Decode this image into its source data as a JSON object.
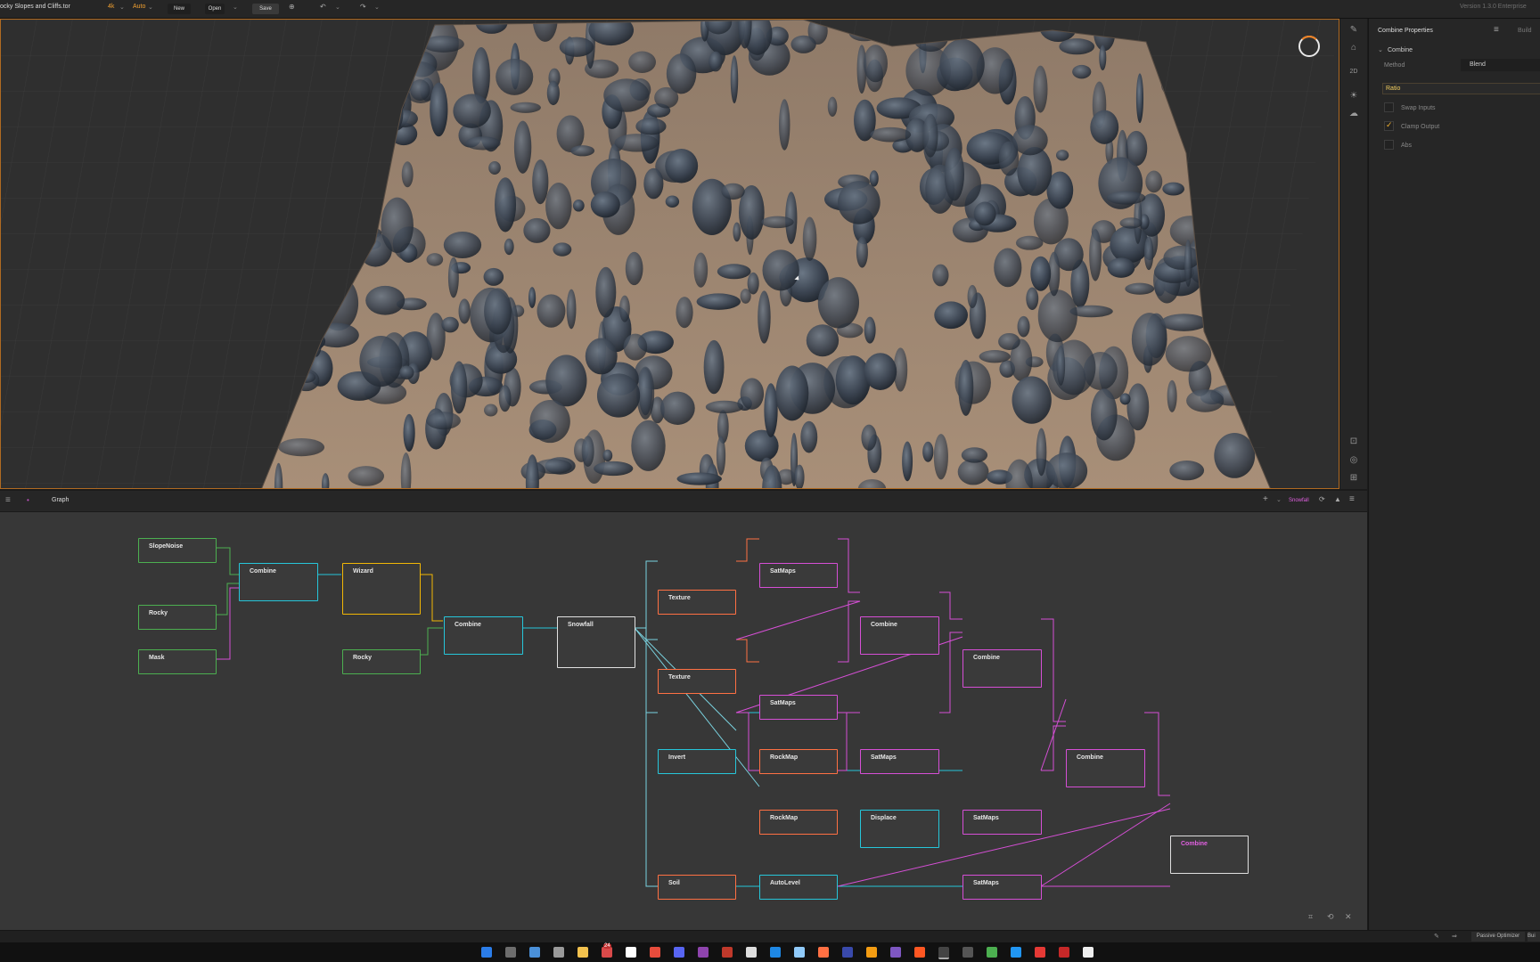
{
  "titlebar": {
    "file_name": "ocky Slopes and Cliffs.tor",
    "resolution": "4k",
    "mode": "Auto",
    "new_label": "New",
    "open_label": "Open",
    "save_label": "Save",
    "version": "Version 1.3.0 Enterprise"
  },
  "viewport": {
    "accent_color": "#b06a22"
  },
  "viewport_tools": {
    "zoom_2d_label": "2D"
  },
  "properties": {
    "panel_title": "Combine Properties",
    "build_label": "Build",
    "section_title": "Combine",
    "method_label": "Method",
    "method_value": "Blend",
    "ratio_label": "Ratio",
    "options": [
      {
        "label": "Swap Inputs",
        "checked": false
      },
      {
        "label": "Clamp Output",
        "checked": true
      },
      {
        "label": "Abs",
        "checked": false
      }
    ]
  },
  "graph": {
    "tab_label": "Graph",
    "active_build": "Snowfall",
    "nodes": [
      {
        "label": "SlopeNoise",
        "color": "green"
      },
      {
        "label": "Rocky",
        "color": "green"
      },
      {
        "label": "Mask",
        "color": "green"
      },
      {
        "label": "Combine",
        "color": "cyan"
      },
      {
        "label": "Wizard",
        "color": "yellow"
      },
      {
        "label": "Rocky",
        "color": "green"
      },
      {
        "label": "Combine",
        "color": "cyan"
      },
      {
        "label": "Snowfall",
        "color": "white"
      },
      {
        "label": "Texture",
        "color": "orange"
      },
      {
        "label": "Texture",
        "color": "orange"
      },
      {
        "label": "Invert",
        "color": "cyan"
      },
      {
        "label": "Soil",
        "color": "orange"
      },
      {
        "label": "SatMaps",
        "color": "magenta"
      },
      {
        "label": "SatMaps",
        "color": "magenta"
      },
      {
        "label": "RockMap",
        "color": "orange"
      },
      {
        "label": "RockMap",
        "color": "orange"
      },
      {
        "label": "AutoLevel",
        "color": "cyan"
      },
      {
        "label": "Combine",
        "color": "magenta"
      },
      {
        "label": "SatMaps",
        "color": "magenta"
      },
      {
        "label": "Displace",
        "color": "cyan"
      },
      {
        "label": "Combine",
        "color": "magenta"
      },
      {
        "label": "SatMaps",
        "color": "magenta"
      },
      {
        "label": "SatMaps",
        "color": "magenta"
      },
      {
        "label": "Combine",
        "color": "magenta"
      },
      {
        "label": "Combine",
        "color": "magenta"
      }
    ]
  },
  "statusbar": {
    "passive_optimizer": "Passive Optimizer",
    "build_short": "Bui"
  },
  "taskbar": {
    "badge_count": "24"
  }
}
